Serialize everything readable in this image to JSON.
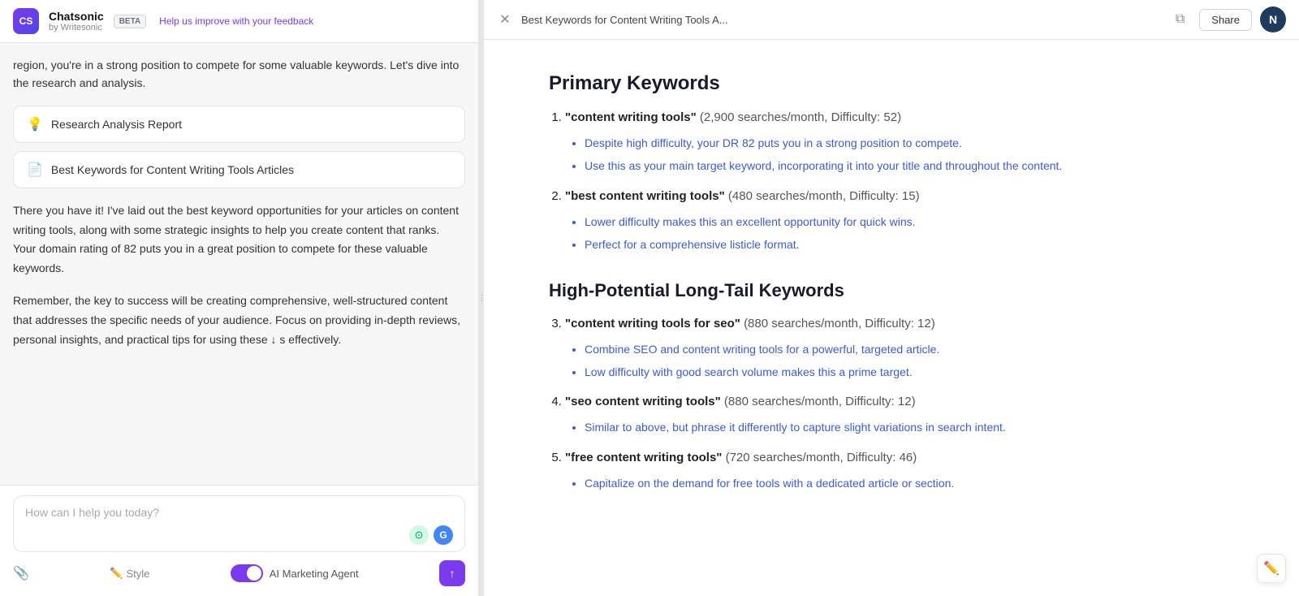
{
  "app": {
    "logo_initials": "CS",
    "brand_name": "Chatsonic",
    "brand_sub": "by Writesonic",
    "beta_label": "BETA",
    "feedback_link": "Help us improve with your feedback"
  },
  "left": {
    "intro_text": "region, you're in a strong position to compete for some valuable keywords. Let's dive into the research and analysis.",
    "card1_label": "Research Analysis Report",
    "card2_label": "Best Keywords for Content Writing Tools Articles",
    "body_text1": "There you have it! I've laid out the best keyword opportunities for your articles on content writing tools, along with some strategic insights to help you create content that ranks. Your domain rating of 82 puts you in a great position to compete for these valuable keywords.",
    "body_text2": "Remember, the key to success will be creating comprehensive, well-structured content that addresses the specific needs of your audience. Focus on providing in-depth reviews, personal insights, and practical tips for using these",
    "body_text2_end": "s effectively.",
    "input_placeholder": "How can I help you today?",
    "style_label": "Style",
    "ai_agent_label": "AI Marketing Agent",
    "send_icon": "↑"
  },
  "right": {
    "doc_title": "Best Keywords for Content Writing Tools A...",
    "share_label": "Share",
    "user_initial": "N",
    "section1_heading": "Primary Keywords",
    "section2_heading": "High-Potential Long-Tail Keywords",
    "keywords": [
      {
        "num": 1,
        "term": "content writing tools",
        "stats": "(2,900 searches/month, Difficulty: 52)",
        "bullets": [
          "Despite high difficulty, your DR 82 puts you in a strong position to compete.",
          "Use this as your main target keyword, incorporating it into your title and throughout the content."
        ]
      },
      {
        "num": 2,
        "term": "best content writing tools",
        "stats": "(480 searches/month, Difficulty: 15)",
        "bullets": [
          "Lower difficulty makes this an excellent opportunity for quick wins.",
          "Perfect for a comprehensive listicle format."
        ]
      },
      {
        "num": 3,
        "term": "content writing tools for seo",
        "stats": "(880 searches/month, Difficulty: 12)",
        "bullets": [
          "Combine SEO and content writing tools for a powerful, targeted article.",
          "Low difficulty with good search volume makes this a prime target."
        ]
      },
      {
        "num": 4,
        "term": "seo content writing tools",
        "stats": "(880 searches/month, Difficulty: 12)",
        "bullets": [
          "Similar to above, but phrase it differently to capture slight variations in search intent."
        ]
      },
      {
        "num": 5,
        "term": "free content writing tools",
        "stats": "(720 searches/month, Difficulty: 46)",
        "bullets": [
          "Capitalize on the demand for free tools with a dedicated article or section."
        ]
      }
    ]
  }
}
